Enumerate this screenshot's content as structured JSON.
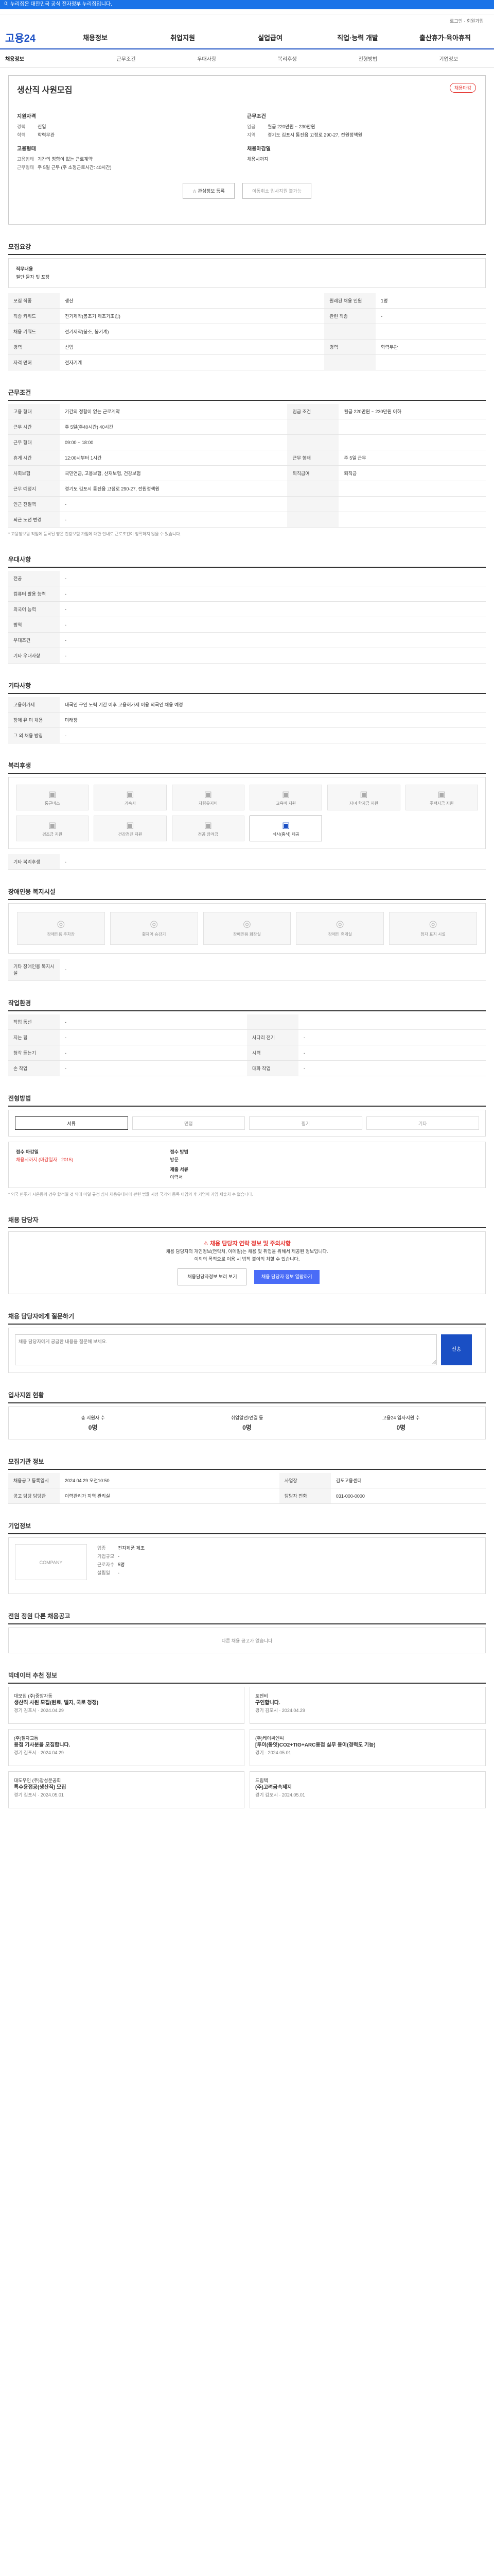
{
  "topbar": "이 누리집은 대한민국 공식 전자정부 누리집입니다.",
  "util": "로그인 · 회원가입",
  "logo": "고용24",
  "gnb": [
    "채용정보",
    "취업지원",
    "실업급여",
    "직업·능력 개발",
    "출산휴가·육아휴직"
  ],
  "lnb": [
    "채용정보",
    "근무조건",
    "우대사항",
    "복리후생",
    "전형방법",
    "기업정보"
  ],
  "job": {
    "title": "생산직 사원모집",
    "badge": "채용마감",
    "left_h": "지원자격",
    "l1k": "경력",
    "l1v": "신입",
    "l2k": "학력",
    "l2v": "학력무관",
    "left_h2": "고용형태",
    "l3k": "고용형태",
    "l3v": "기간의 정함이 없는 근로계약",
    "l4k": "근무형태",
    "l4v": "주 5일 근무 (주 소정근로시간: 40시간)",
    "right_h": "근무조건",
    "r1k": "임금",
    "r1v": "월급 220만원 ~ 230만원",
    "r2k": "지역",
    "r2v": "경기도 김포시 통진읍 고정로 290-27, 전원정책원",
    "right_h2": "채용마감일",
    "r3v": "채용시까지",
    "btn1": "관심정보 등록",
    "btn2": "이동취소 입사지원 불가능"
  },
  "s_recruit": {
    "title": "모집요강",
    "h": "직무내용",
    "v": "필단 물자 및 포장"
  },
  "recruit_table": [
    [
      "모집 직종",
      "생산",
      "원래된 채용 인원",
      "1명"
    ],
    [
      "직종 키워드",
      "전기제작(봉조기 제조기조립)",
      "관련 직종",
      "-"
    ],
    [
      "채용 키워드",
      "전기제작(봉조, 봉기계)",
      "",
      ""
    ],
    [
      "경력",
      "신입",
      "경력",
      "학력무관"
    ],
    [
      "자격 면허",
      "전자기계",
      "",
      ""
    ]
  ],
  "s_cond": {
    "title": "근무조건"
  },
  "cond_table": [
    [
      "고용 형태",
      "기간의 정함이 없는 근로계약",
      "임금 조건",
      "월급 220만원 ~ 230만원 이하"
    ],
    [
      "근무 시간",
      "주 5일(주40시간) 40시간",
      "",
      ""
    ],
    [
      "근무 형태",
      "09:00 ~ 18:00",
      "",
      ""
    ],
    [
      "휴게 시간",
      "12:00시부터 1시간",
      "근무 형태",
      "주 5일 근무"
    ],
    [
      "사회보험",
      "국민연금, 고용보험, 산재보험, 건강보험",
      "퇴직급여",
      "퇴직금"
    ],
    [
      "근무 예정지",
      "경기도 김포시 통진읍 고정로 290-27, 전원정책원",
      "",
      ""
    ],
    [
      "인근 전철역",
      "-",
      "",
      ""
    ],
    [
      "퇴근 노선 변경",
      "-",
      "",
      ""
    ]
  ],
  "cond_note": "* 고용정보원 직업에 등록된 명은 건강보험 가입에 대한 안내로 근로조건이 정확하지 않을 수 있습니다.",
  "s_pref": {
    "title": "우대사항"
  },
  "pref_table": [
    [
      "전공",
      "-"
    ],
    [
      "컴퓨터 활용 능력",
      "-"
    ],
    [
      "외국어 능력",
      "-"
    ],
    [
      "병역",
      "-"
    ],
    [
      "우대조건",
      "-"
    ],
    [
      "기타 우대사항",
      "-"
    ]
  ],
  "s_etc": {
    "title": "기타사항"
  },
  "etc_table": [
    [
      "고용허가제",
      "내국인 구인 노력 기간 이후 고용허가제 이용 외국인 채용 예정"
    ],
    [
      "장애 유 미 채용",
      "미래장"
    ],
    [
      "그 외 채용 방침",
      "-"
    ]
  ],
  "s_welfare": {
    "title": "복리후생"
  },
  "welfare_icons": [
    "통근버스",
    "기숙사",
    "차량유지비",
    "교육비 지원",
    "자녀 학자금 지원",
    "주택자금 지원",
    "경조금 지원",
    "건강검진 지원",
    "전공 장려금",
    "식사(중식) 제공"
  ],
  "welfare_etc_k": "기타 복리후생",
  "welfare_etc_v": "-",
  "s_disabled": {
    "title": "장애인용 복지시설"
  },
  "disabled_icons": [
    "장애인용 주차장",
    "휠체어 승강기",
    "장애인용 화장실",
    "장애인 휴게실",
    "점자 표지 시설"
  ],
  "disabled_k": "기타 장애인용 복지시설",
  "disabled_v": "-",
  "s_env": {
    "title": "작업환경"
  },
  "env_table": [
    [
      "작업 동선",
      "-",
      "",
      ""
    ],
    [
      "지는 힘",
      "-",
      "사다리 전기",
      "-"
    ],
    [
      "청각 듣는기",
      "-",
      "시력",
      "-"
    ],
    [
      "손 작업",
      "-",
      "대화 작업",
      "-"
    ]
  ],
  "s_method": {
    "title": "전형방법"
  },
  "steps": [
    "서류",
    "면접",
    "필기",
    "기타"
  ],
  "contact": {
    "k1": "접수 마감일",
    "v1": "채용시까지 (마감일자 · 2015)",
    "k2": "접수 방법",
    "v2": "방문",
    "k3": "제출 서류",
    "v3": "이력서",
    "note": "* 외국 민주가 시운동의 경우 합격일 것 외에 미일 규정 심사 채용유대서에 관한 법률 시정 국가와 등록 내입의 후 기업이 가입 제출처 수 없습니다."
  },
  "s_staff": {
    "title": "채용 담당자"
  },
  "warn": {
    "w": "채용 담당자 연락 정보 및 주의사항",
    "l1": "채용 담당자의 개인정보(연락처, 이메일)는 채용 및 취업을 위해서 제공된 정보입니다.",
    "l2": "이외의 목적으로 이용 시 법적 불이익 처할 수 있습니다.",
    "b1": "채용담당자정보 보러 보기",
    "b2": "채용 담당자 정보 열람하기"
  },
  "s_question": {
    "title": "채용 담당자에게 질문하기"
  },
  "chat": {
    "placeholder": "채용 담당자에게 궁금한 내용을 질문해 보세요.",
    "send": "전송"
  },
  "s_applicant": {
    "title": "입사지원 현황"
  },
  "stats": [
    [
      "총 지원자 수",
      "0명"
    ],
    [
      "취업알선/연결 등",
      "0명"
    ],
    [
      "고용24 입사지원 수",
      "0명"
    ]
  ],
  "s_manage": {
    "title": "모집기관 정보"
  },
  "manage_table": [
    [
      "채용공고 등록일시",
      "2024.04.29 오전10:50",
      "사업장",
      "김포고용센터"
    ],
    [
      "공고 담당 담당관",
      "이력관리가 지역 관리실",
      "담당자 전화",
      "031-000-0000"
    ]
  ],
  "s_company": {
    "title": "기업정보"
  },
  "company": {
    "logo": "COMPANY",
    "k1": "업종",
    "v1": "전자제품 제조",
    "k2": "기업규모",
    "v2": "-",
    "k3": "근로자수",
    "v3": "5명",
    "k4": "설립일",
    "v4": "-"
  },
  "s_other": {
    "title": "전원 정원 다른 채용공고"
  },
  "other_empty": "다른 채용 공고가 없습니다",
  "s_rec": {
    "title": "빅데이터 추천 정보"
  },
  "recs": [
    [
      "대모집 (주)중앙자동",
      "생산직 사원 모집(원료, 벨지, 국로 청정)",
      "경기 김포시 · 2024.04.29"
    ],
    [
      "토펜비",
      "구인합니다.",
      "경기 김포시 · 2024.04.29"
    ],
    [
      "(주)철자교통",
      "용접 기사분을 모집합니다.",
      "경기 김포시 · 2024.04.29"
    ],
    [
      "(주)케이씨엔씨",
      "[투이(동잇)CO2+TIG+ARC용접 실무 용이(경력도 기능)",
      "경기 · 2024.05.01"
    ],
    [
      "대도우인 (주)창성분공회",
      "특수용접공(생산직) 모집",
      "경기 김포시 · 2024.05.01"
    ],
    [
      "드림텍",
      "(주)고려금속제지",
      "경기 김포시 · 2024.05.01"
    ]
  ]
}
